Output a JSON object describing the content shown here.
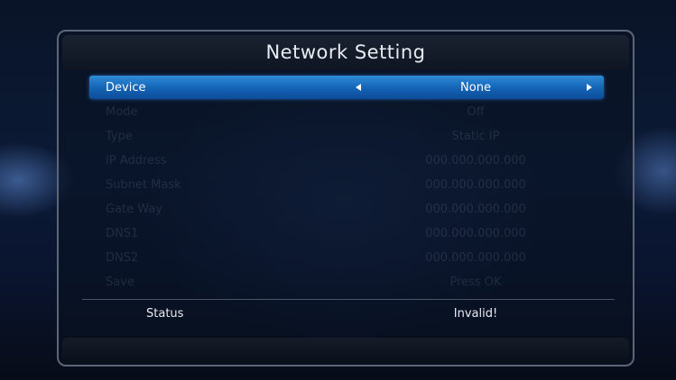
{
  "title": "Network Setting",
  "rows": [
    {
      "label": "Device",
      "value": "None"
    },
    {
      "label": "Mode",
      "value": "Off"
    },
    {
      "label": "Type",
      "value": "Static IP"
    },
    {
      "label": "IP Address",
      "value": "000.000.000.000"
    },
    {
      "label": "Subnet Mask",
      "value": "000.000.000.000"
    },
    {
      "label": "Gate Way",
      "value": "000.000.000.000"
    },
    {
      "label": "DNS1",
      "value": "000.000.000.000"
    },
    {
      "label": "DNS2",
      "value": "000.000.000.000"
    },
    {
      "label": "Save",
      "value": "Press OK"
    }
  ],
  "status": {
    "label": "Status",
    "value": "Invalid!"
  },
  "colors": {
    "selection": "#1565b8",
    "text": "#e8ecf2"
  }
}
